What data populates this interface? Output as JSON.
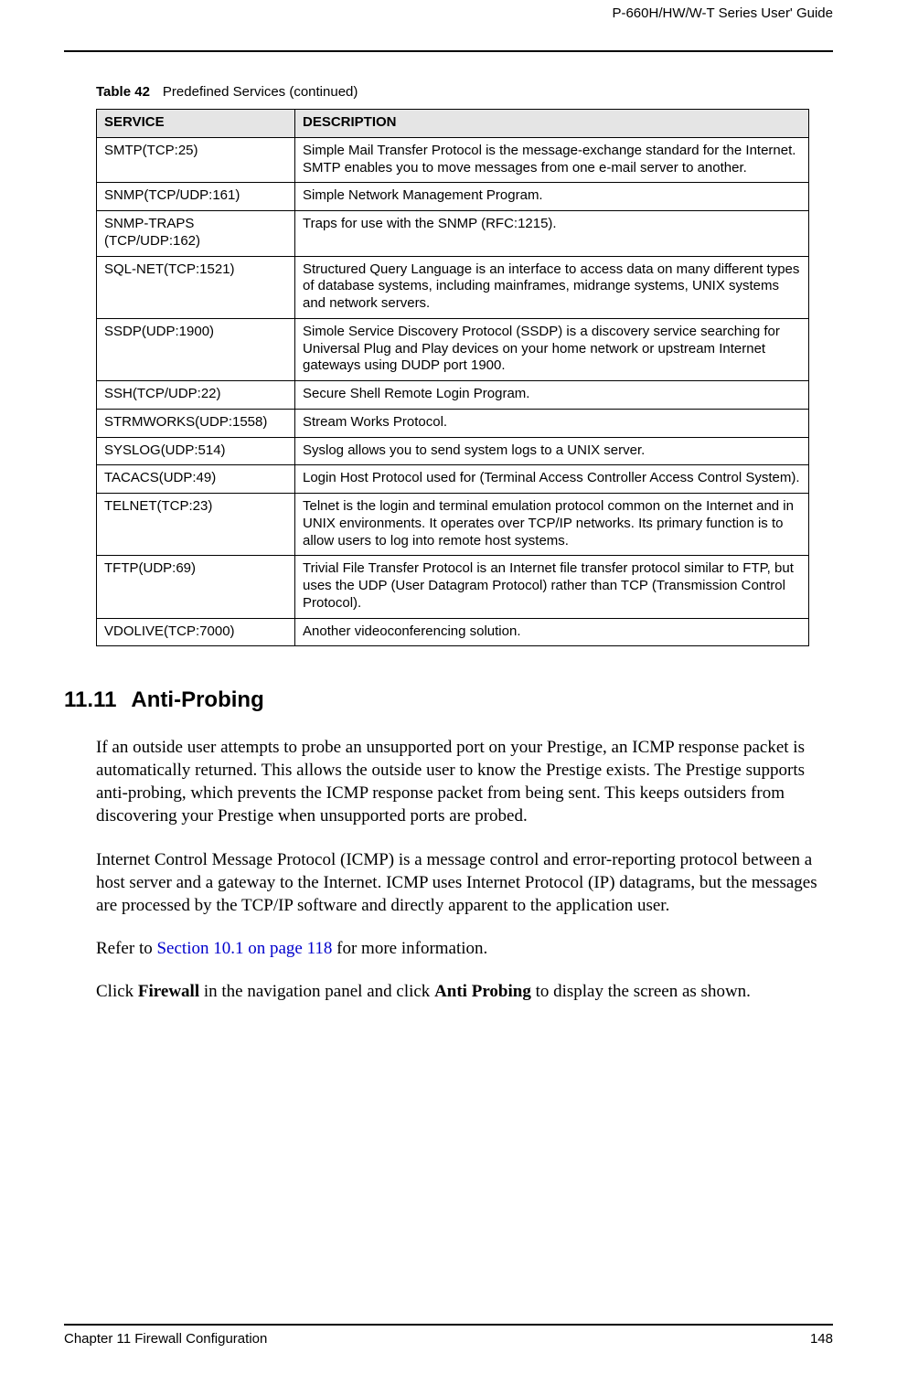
{
  "header": {
    "guide_title": "P-660H/HW/W-T Series User' Guide"
  },
  "table": {
    "label": "Table 42",
    "caption": "Predefined Services (continued)",
    "columns": {
      "service": "SERVICE",
      "description": "DESCRIPTION"
    },
    "rows": [
      {
        "service": "SMTP(TCP:25)",
        "description": "Simple Mail Transfer Protocol is the message-exchange standard for the Internet. SMTP enables you to move messages from one e-mail server to another."
      },
      {
        "service": "SNMP(TCP/UDP:161)",
        "description": "Simple Network Management Program."
      },
      {
        "service": "SNMP-TRAPS (TCP/UDP:162)",
        "description": "Traps for use with the SNMP (RFC:1215)."
      },
      {
        "service": "SQL-NET(TCP:1521)",
        "description": "Structured Query Language is an interface to access data on many different types of database systems, including mainframes, midrange systems, UNIX systems and network servers."
      },
      {
        "service": "SSDP(UDP:1900)",
        "description": "Simole Service Discovery Protocol (SSDP) is a discovery service searching for Universal Plug and Play devices on your home network or upstream Internet gateways using DUDP port 1900."
      },
      {
        "service": "SSH(TCP/UDP:22)",
        "description": "Secure Shell Remote Login Program."
      },
      {
        "service": "STRMWORKS(UDP:1558)",
        "description": "Stream Works Protocol."
      },
      {
        "service": "SYSLOG(UDP:514)",
        "description": "Syslog allows you to send system logs to a UNIX server."
      },
      {
        "service": "TACACS(UDP:49)",
        "description": "Login Host Protocol used for (Terminal Access Controller  Access Control System)."
      },
      {
        "service": "TELNET(TCP:23)",
        "description": "Telnet is the login and terminal emulation protocol common on the Internet and in UNIX environments. It operates over TCP/IP networks. Its primary function is to allow users to log into remote host systems."
      },
      {
        "service": "TFTP(UDP:69)",
        "description": "Trivial File Transfer Protocol is an Internet file transfer protocol similar to FTP, but uses the UDP (User Datagram Protocol) rather than TCP (Transmission Control Protocol)."
      },
      {
        "service": "VDOLIVE(TCP:7000)",
        "description": "Another videoconferencing solution."
      }
    ]
  },
  "section": {
    "number": "11.11",
    "title": "Anti-Probing",
    "para1": "If an outside user attempts to probe an unsupported port on your Prestige, an ICMP response packet is automatically returned.  This allows the outside user to know the Prestige exists. The Prestige supports anti-probing, which prevents the ICMP response packet from being sent. This keeps outsiders from discovering your Prestige when unsupported ports are probed.",
    "para2": "Internet Control Message Protocol (ICMP) is a message control and error-reporting protocol between a host server and a gateway to the Internet. ICMP uses Internet Protocol (IP) datagrams, but the messages are processed by the TCP/IP software and directly apparent to the application user.",
    "para3_prefix": "Refer to ",
    "para3_link": "Section 10.1 on page 118",
    "para3_suffix": " for more information.",
    "para4_part1": "Click ",
    "para4_bold1": "Firewall",
    "para4_part2": " in the navigation panel and click ",
    "para4_bold2": "Anti Probing",
    "para4_part3": " to display the screen as shown."
  },
  "footer": {
    "chapter": "Chapter 11 Firewall Configuration",
    "page": "148"
  }
}
